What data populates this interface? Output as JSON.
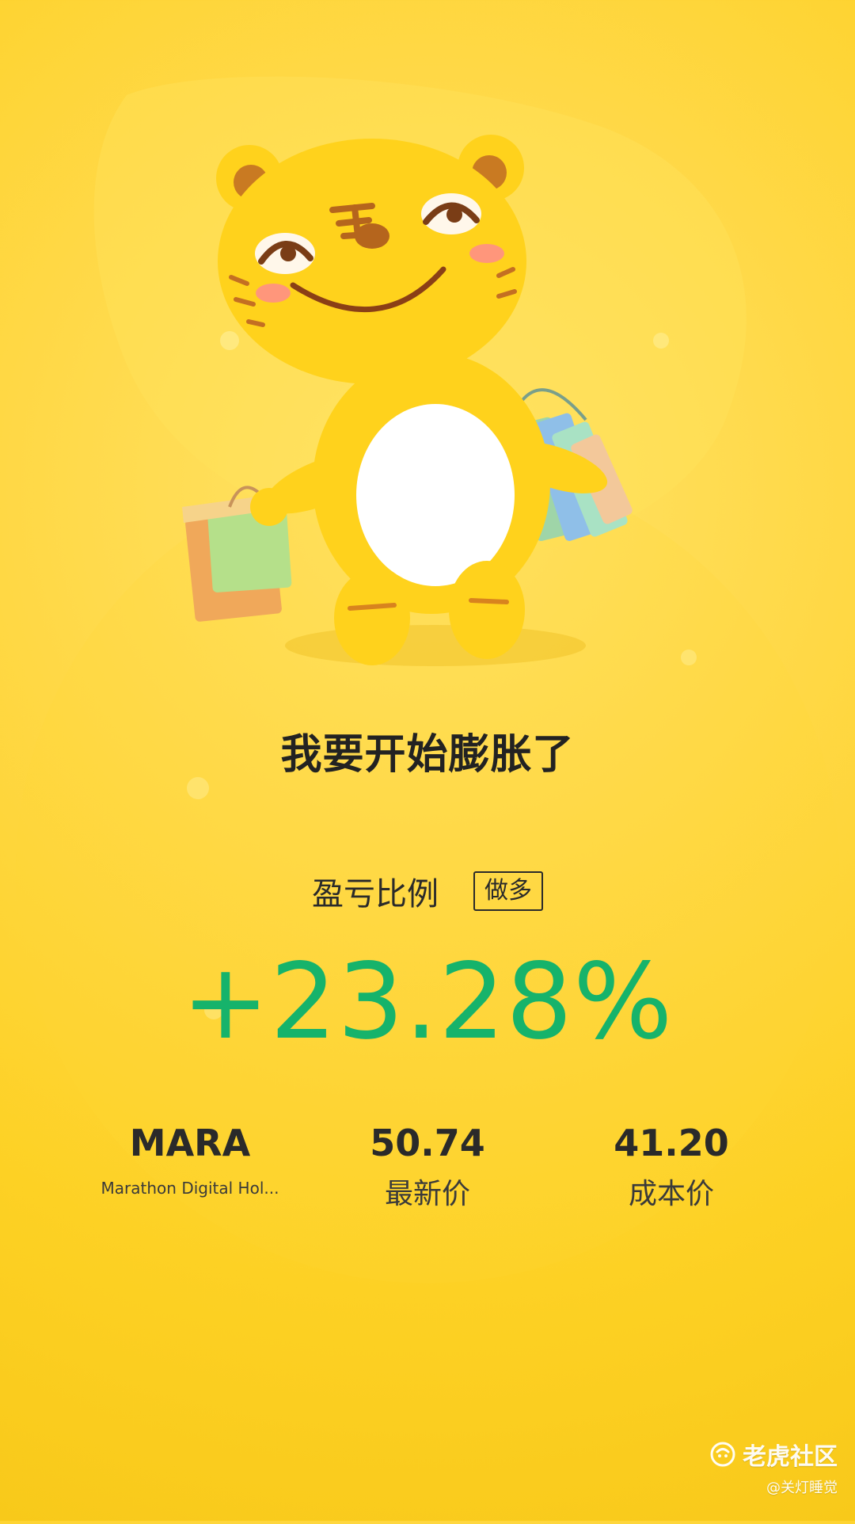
{
  "headline": "我要开始膨胀了",
  "ratio": {
    "label": "盈亏比例",
    "position_type": "做多",
    "value": "+23.28%"
  },
  "stats": {
    "ticker": "MARA",
    "company_name": "Marathon Digital Hol...",
    "latest_price": "50.74",
    "latest_price_label": "最新价",
    "cost_price": "41.20",
    "cost_price_label": "成本价"
  },
  "watermark": {
    "brand": "老虎社区",
    "user": "@关灯睡觉"
  },
  "colors": {
    "background": "#fdd124",
    "gain_green": "#16b36b",
    "text_dark": "#2a2a2a"
  },
  "icons": {
    "mascot": "tiger-mascot-with-shopping-bags",
    "watermark_logo": "tiger-logo-icon"
  }
}
